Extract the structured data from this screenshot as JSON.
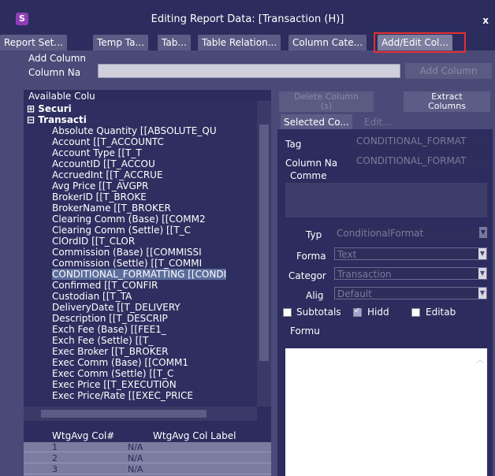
{
  "window": {
    "title": "Editing Report Data: [Transaction (H)]",
    "app_icon_glyph": "S",
    "close_glyph": "x"
  },
  "tabs": [
    {
      "label": "Report Set...",
      "active": false
    },
    {
      "label": "Temp Ta...",
      "active": false
    },
    {
      "label": "Tab...",
      "active": false
    },
    {
      "label": "Table Relation...",
      "active": false
    },
    {
      "label": "Column Cate...",
      "active": false
    },
    {
      "label": "Add/Edit Col...",
      "active": true
    }
  ],
  "add_column": {
    "section_label": "Add Column",
    "column_name_label": "Column Na",
    "column_name_value": "",
    "add_button": "Add Column"
  },
  "available": {
    "section_label": "Available Colu",
    "groups": [
      {
        "expander": "⊞",
        "label": "Securi"
      },
      {
        "expander": "⊟",
        "label": "Transacti"
      }
    ],
    "items": [
      "Absolute Quantity [[ABSOLUTE_QU",
      "Account [[T_ACCOUNTC",
      "Account Type [[T_T",
      "AccountID [[T_ACCOU",
      "AccruedInt [[T_ACCRUE",
      "Avg Price [[T_AVGPR",
      "BrokerID [[T_BROKE",
      "BrokerName [[T_BROKER",
      "Clearing Comm (Base) [[COMM2",
      "Clearing Comm (Settle) [[T_C",
      "ClOrdID [[T_CLOR",
      "Commission (Base) [[COMMISSI",
      "Commission (Settle) [[T_COMMI",
      "CONDITIONAL_FORMATTING [[CONDI",
      "Confirmed [[T_CONFIR",
      "Custodian [[T_TA",
      "DeliveryDate [[T_DELIVERY",
      "Description [[T_DESCRIP",
      "Exch Fee (Base) [[FEE1_",
      "Exch Fee (Settle) [[T_",
      "Exec Broker [[T_BROKER",
      "Exec Comm (Base) [[COMM1",
      "Exec Comm (Settle) [[T_C",
      "Exec Price [[T_EXECUTION",
      "Exec Price/Rate [[EXEC_PRICE"
    ],
    "selected_index": 13
  },
  "wtg": {
    "col_header": "WtgAvg Col#",
    "label_header": "WtgAvg Col Label",
    "rows": [
      {
        "num": "1",
        "label": "N/A"
      },
      {
        "num": "2",
        "label": "N/A"
      },
      {
        "num": "3",
        "label": "N/A"
      }
    ]
  },
  "actions": {
    "delete_line1": "Delete Column",
    "delete_line2": "(s)",
    "extract_line1": "Extract",
    "extract_line2": "Columns"
  },
  "subtabs": [
    {
      "label": "Selected Co...",
      "active": true
    },
    {
      "label": "Edit...",
      "active": false
    }
  ],
  "selected": {
    "tag_label": "Tag",
    "tag_value": "CONDITIONAL_FORMAT",
    "colname_label": "Column Na",
    "colname_value": "CONDITIONAL_FORMAT",
    "comment_label": "Comme",
    "type_label": "Typ",
    "type_value": "ConditionalFormat",
    "format_label": "Forma",
    "format_value": "Text",
    "category_label": "Categor",
    "category_value": "Transaction",
    "align_label": "Alig",
    "align_value": "Default",
    "subtotals_label": "Subtotals",
    "subtotals_checked": false,
    "hidden_label": "Hidd",
    "hidden_checked": true,
    "editable_label": "Editab",
    "editable_checked": false,
    "formula_label": "Formu"
  }
}
